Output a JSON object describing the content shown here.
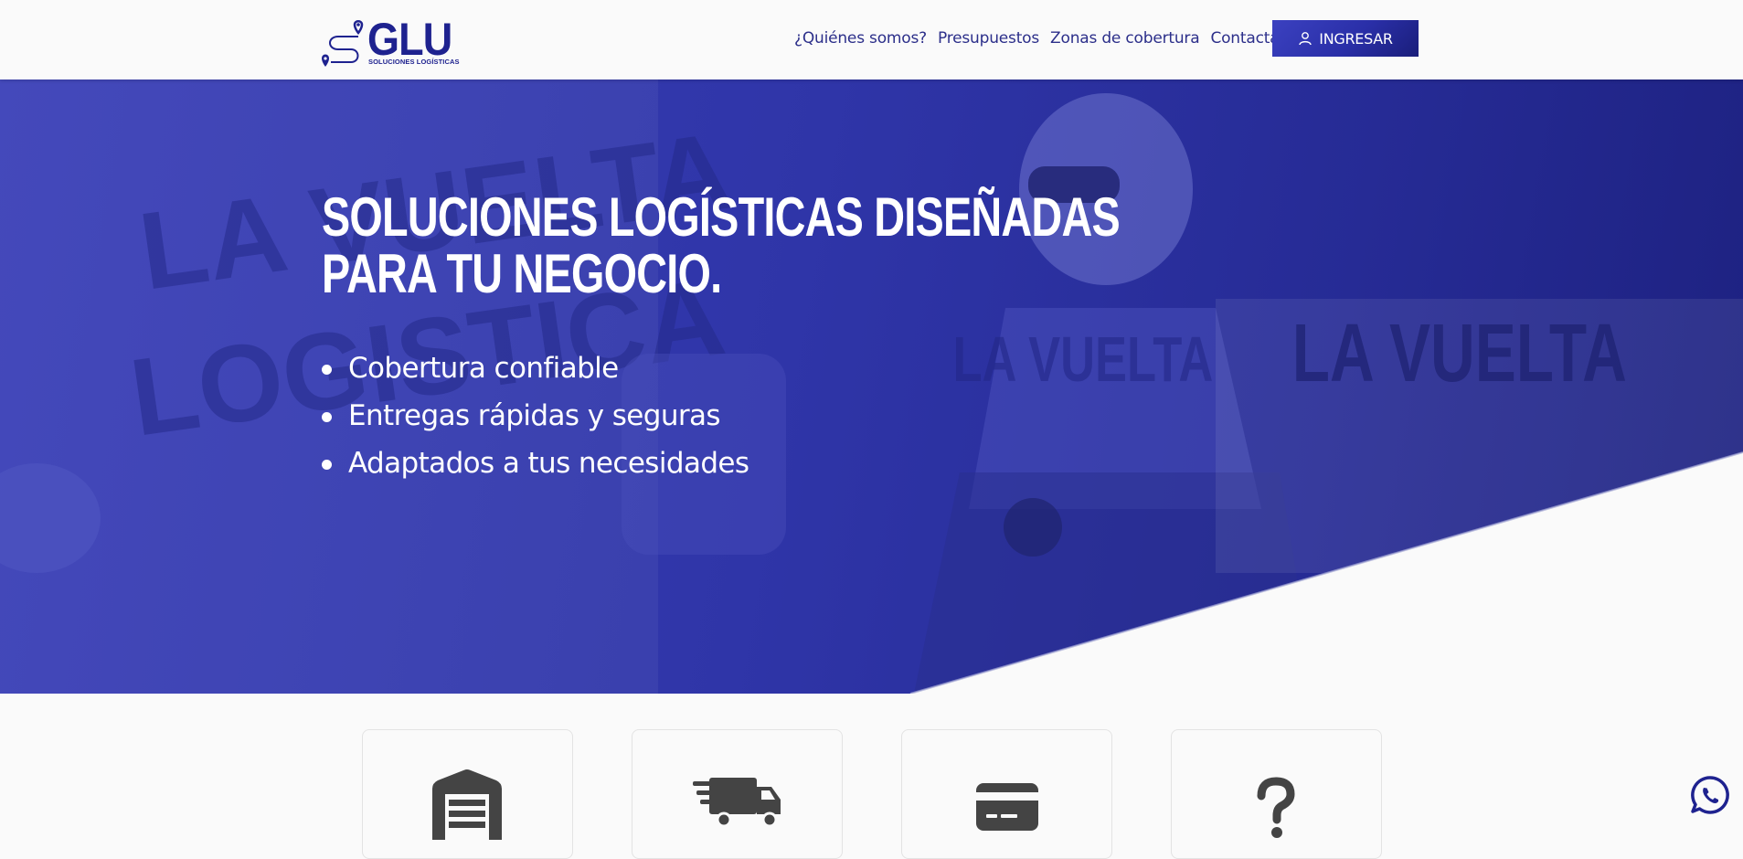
{
  "header": {
    "logo": {
      "word": "GLU",
      "subtitle": "SOLUCIONES LOGÍSTICAS"
    },
    "nav": [
      {
        "label": "¿Quiénes somos?"
      },
      {
        "label": "Presupuestos"
      },
      {
        "label": "Zonas de cobertura"
      },
      {
        "label": "Contactar"
      }
    ],
    "login_label": "INGRESAR"
  },
  "hero": {
    "title_line1": "SOLUCIONES LOGÍSTICAS DISEÑADAS",
    "title_line2": "PARA TU NEGOCIO.",
    "bullets": [
      "Cobertura confiable",
      "Entregas rápidas y seguras",
      "Adaptados a tus necesidades"
    ],
    "background_text": [
      "LA VUELTA",
      "LOGISTICA"
    ]
  },
  "cards": [
    {
      "icon": "warehouse-icon"
    },
    {
      "icon": "delivery-truck-icon"
    },
    {
      "icon": "credit-card-icon"
    },
    {
      "icon": "question-icon"
    }
  ],
  "colors": {
    "brand": "#1e228f",
    "hero_blue": "#2f35a8",
    "nav_text": "#2c2f8a",
    "background": "#fafafa",
    "whatsapp": "#1e228f"
  }
}
